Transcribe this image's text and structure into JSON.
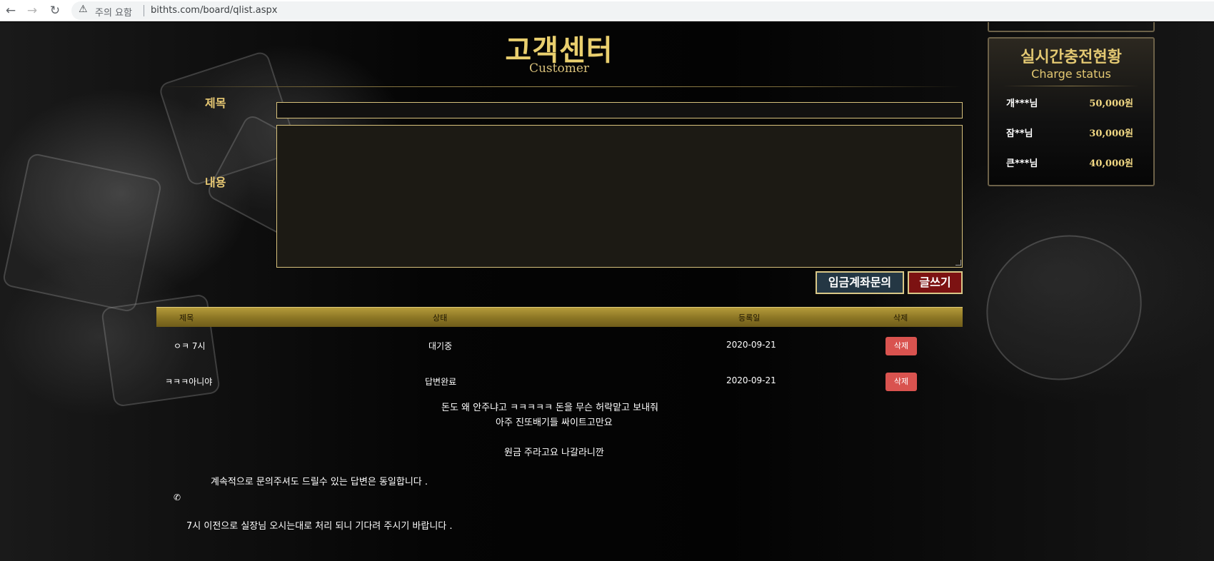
{
  "browser": {
    "security_warning": "주의 요함",
    "url": "bithts.com/board/qlist.aspx",
    "icons": [
      "back-arrow-icon",
      "forward-arrow-icon",
      "reload-icon",
      "warning-icon"
    ]
  },
  "header": {
    "title": "고객센터",
    "subtitle": "Customer"
  },
  "form": {
    "subject_label": "제목",
    "content_label": "내용",
    "subject_value": "",
    "content_value": "",
    "deposit_inquiry_button": "입금계좌문의",
    "write_button": "글쓰기"
  },
  "table": {
    "headers": [
      "제목",
      "상태",
      "등록일",
      "삭제"
    ],
    "rows": [
      {
        "subject": "ㅇㅋ 7시",
        "status": "대기중",
        "date": "2020-09-21",
        "delete_label": "삭제"
      },
      {
        "subject": "ㅋㅋㅋ아니야",
        "status": "답변완료",
        "date": "2020-09-21",
        "delete_label": "삭제"
      }
    ]
  },
  "answer": {
    "lines": [
      "돈도 왜 안주냐고 ㅋㅋㅋㅋㅋ 돈을 무슨 허락맡고 보내줘",
      "아주 진또배기들 싸이트고만요",
      "원금 주라고요 나갈라니깐",
      "계속적으로 문의주셔도 드릴수 있는 답변은 동일합니다 .",
      "7시 이전으로 실장님 오시는대로 처리 되니 기다려 주시기 바랍니다 ."
    ]
  },
  "charge_status": {
    "title": "실시간충전현황",
    "subtitle": "Charge status",
    "entries": [
      {
        "name": "개***님",
        "amount": "50,000원"
      },
      {
        "name": "잠**님",
        "amount": "30,000원"
      },
      {
        "name": "큰***님",
        "amount": "40,000원"
      }
    ]
  },
  "colors": {
    "gold": "#e7c873",
    "header_gold": "#b59b3a",
    "delete_red": "#d9534f",
    "write_button_red": "#7c1212",
    "deposit_button_navy": "#243744"
  }
}
